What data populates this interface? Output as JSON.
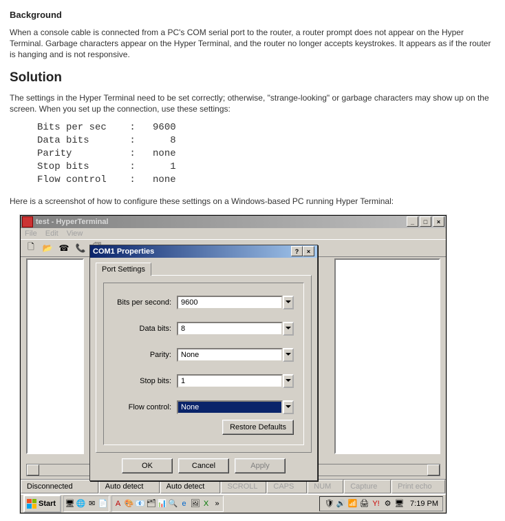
{
  "doc": {
    "h_background": "Background",
    "p_background": "When a console cable is connected from a PC's COM serial port to the router, a router prompt does not appear on the Hyper Terminal. Garbage characters appear on the Hyper Terminal, and the router no longer accepts keystrokes. It appears as if the router is hanging and is not responsive.",
    "h_solution": "Solution",
    "p_solution": "The settings in the Hyper Terminal need to be set correctly; otherwise, \"strange-looking\" or garbage characters may show up on the screen. When you set up the connection, use these settings:",
    "settings_text": "Bits per sec    :   9600\nData bits       :      8\nParity          :   none\nStop bits       :      1\nFlow control    :   none",
    "p_screenshot": "Here is a screenshot of how to configure these settings on a Windows-based PC running Hyper Terminal:"
  },
  "hyper": {
    "title": "test - HyperTerminal",
    "menu": {
      "file": "File",
      "edit": "Edit",
      "view": "View"
    }
  },
  "dialog": {
    "title": "COM1 Properties",
    "tab": "Port Settings",
    "fields": {
      "bps": {
        "label": "Bits per second:",
        "value": "9600"
      },
      "data": {
        "label": "Data bits:",
        "value": "8"
      },
      "parity": {
        "label": "Parity:",
        "value": "None"
      },
      "stop": {
        "label": "Stop bits:",
        "value": "1"
      },
      "flow": {
        "label": "Flow control:",
        "value": "None"
      }
    },
    "restore": "Restore Defaults",
    "ok": "OK",
    "cancel": "Cancel",
    "apply": "Apply"
  },
  "status": {
    "conn": "Disconnected",
    "ad1": "Auto detect",
    "ad2": "Auto detect",
    "scroll": "SCROLL",
    "caps": "CAPS",
    "num": "NUM",
    "capture": "Capture",
    "print": "Print echo"
  },
  "taskbar": {
    "start": "Start",
    "clock": "7:19 PM"
  }
}
